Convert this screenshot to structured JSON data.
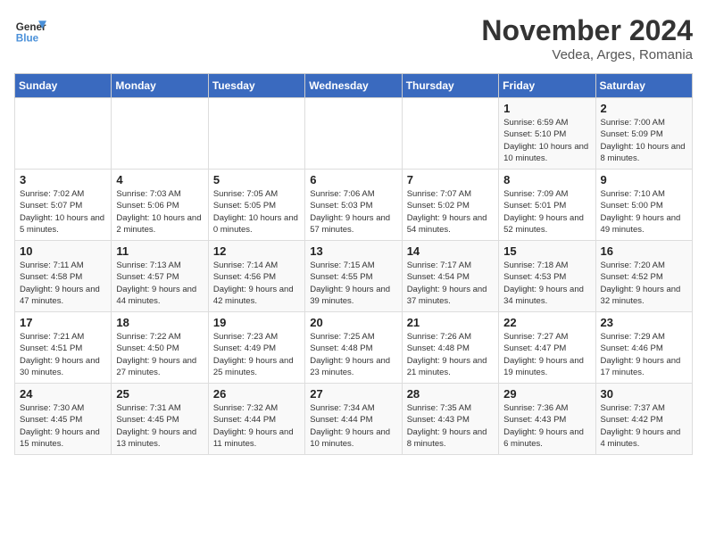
{
  "header": {
    "logo_general": "General",
    "logo_blue": "Blue",
    "month": "November 2024",
    "location": "Vedea, Arges, Romania"
  },
  "weekdays": [
    "Sunday",
    "Monday",
    "Tuesday",
    "Wednesday",
    "Thursday",
    "Friday",
    "Saturday"
  ],
  "weeks": [
    [
      {
        "day": "",
        "info": ""
      },
      {
        "day": "",
        "info": ""
      },
      {
        "day": "",
        "info": ""
      },
      {
        "day": "",
        "info": ""
      },
      {
        "day": "",
        "info": ""
      },
      {
        "day": "1",
        "info": "Sunrise: 6:59 AM\nSunset: 5:10 PM\nDaylight: 10 hours and 10 minutes."
      },
      {
        "day": "2",
        "info": "Sunrise: 7:00 AM\nSunset: 5:09 PM\nDaylight: 10 hours and 8 minutes."
      }
    ],
    [
      {
        "day": "3",
        "info": "Sunrise: 7:02 AM\nSunset: 5:07 PM\nDaylight: 10 hours and 5 minutes."
      },
      {
        "day": "4",
        "info": "Sunrise: 7:03 AM\nSunset: 5:06 PM\nDaylight: 10 hours and 2 minutes."
      },
      {
        "day": "5",
        "info": "Sunrise: 7:05 AM\nSunset: 5:05 PM\nDaylight: 10 hours and 0 minutes."
      },
      {
        "day": "6",
        "info": "Sunrise: 7:06 AM\nSunset: 5:03 PM\nDaylight: 9 hours and 57 minutes."
      },
      {
        "day": "7",
        "info": "Sunrise: 7:07 AM\nSunset: 5:02 PM\nDaylight: 9 hours and 54 minutes."
      },
      {
        "day": "8",
        "info": "Sunrise: 7:09 AM\nSunset: 5:01 PM\nDaylight: 9 hours and 52 minutes."
      },
      {
        "day": "9",
        "info": "Sunrise: 7:10 AM\nSunset: 5:00 PM\nDaylight: 9 hours and 49 minutes."
      }
    ],
    [
      {
        "day": "10",
        "info": "Sunrise: 7:11 AM\nSunset: 4:58 PM\nDaylight: 9 hours and 47 minutes."
      },
      {
        "day": "11",
        "info": "Sunrise: 7:13 AM\nSunset: 4:57 PM\nDaylight: 9 hours and 44 minutes."
      },
      {
        "day": "12",
        "info": "Sunrise: 7:14 AM\nSunset: 4:56 PM\nDaylight: 9 hours and 42 minutes."
      },
      {
        "day": "13",
        "info": "Sunrise: 7:15 AM\nSunset: 4:55 PM\nDaylight: 9 hours and 39 minutes."
      },
      {
        "day": "14",
        "info": "Sunrise: 7:17 AM\nSunset: 4:54 PM\nDaylight: 9 hours and 37 minutes."
      },
      {
        "day": "15",
        "info": "Sunrise: 7:18 AM\nSunset: 4:53 PM\nDaylight: 9 hours and 34 minutes."
      },
      {
        "day": "16",
        "info": "Sunrise: 7:20 AM\nSunset: 4:52 PM\nDaylight: 9 hours and 32 minutes."
      }
    ],
    [
      {
        "day": "17",
        "info": "Sunrise: 7:21 AM\nSunset: 4:51 PM\nDaylight: 9 hours and 30 minutes."
      },
      {
        "day": "18",
        "info": "Sunrise: 7:22 AM\nSunset: 4:50 PM\nDaylight: 9 hours and 27 minutes."
      },
      {
        "day": "19",
        "info": "Sunrise: 7:23 AM\nSunset: 4:49 PM\nDaylight: 9 hours and 25 minutes."
      },
      {
        "day": "20",
        "info": "Sunrise: 7:25 AM\nSunset: 4:48 PM\nDaylight: 9 hours and 23 minutes."
      },
      {
        "day": "21",
        "info": "Sunrise: 7:26 AM\nSunset: 4:48 PM\nDaylight: 9 hours and 21 minutes."
      },
      {
        "day": "22",
        "info": "Sunrise: 7:27 AM\nSunset: 4:47 PM\nDaylight: 9 hours and 19 minutes."
      },
      {
        "day": "23",
        "info": "Sunrise: 7:29 AM\nSunset: 4:46 PM\nDaylight: 9 hours and 17 minutes."
      }
    ],
    [
      {
        "day": "24",
        "info": "Sunrise: 7:30 AM\nSunset: 4:45 PM\nDaylight: 9 hours and 15 minutes."
      },
      {
        "day": "25",
        "info": "Sunrise: 7:31 AM\nSunset: 4:45 PM\nDaylight: 9 hours and 13 minutes."
      },
      {
        "day": "26",
        "info": "Sunrise: 7:32 AM\nSunset: 4:44 PM\nDaylight: 9 hours and 11 minutes."
      },
      {
        "day": "27",
        "info": "Sunrise: 7:34 AM\nSunset: 4:44 PM\nDaylight: 9 hours and 10 minutes."
      },
      {
        "day": "28",
        "info": "Sunrise: 7:35 AM\nSunset: 4:43 PM\nDaylight: 9 hours and 8 minutes."
      },
      {
        "day": "29",
        "info": "Sunrise: 7:36 AM\nSunset: 4:43 PM\nDaylight: 9 hours and 6 minutes."
      },
      {
        "day": "30",
        "info": "Sunrise: 7:37 AM\nSunset: 4:42 PM\nDaylight: 9 hours and 4 minutes."
      }
    ]
  ]
}
